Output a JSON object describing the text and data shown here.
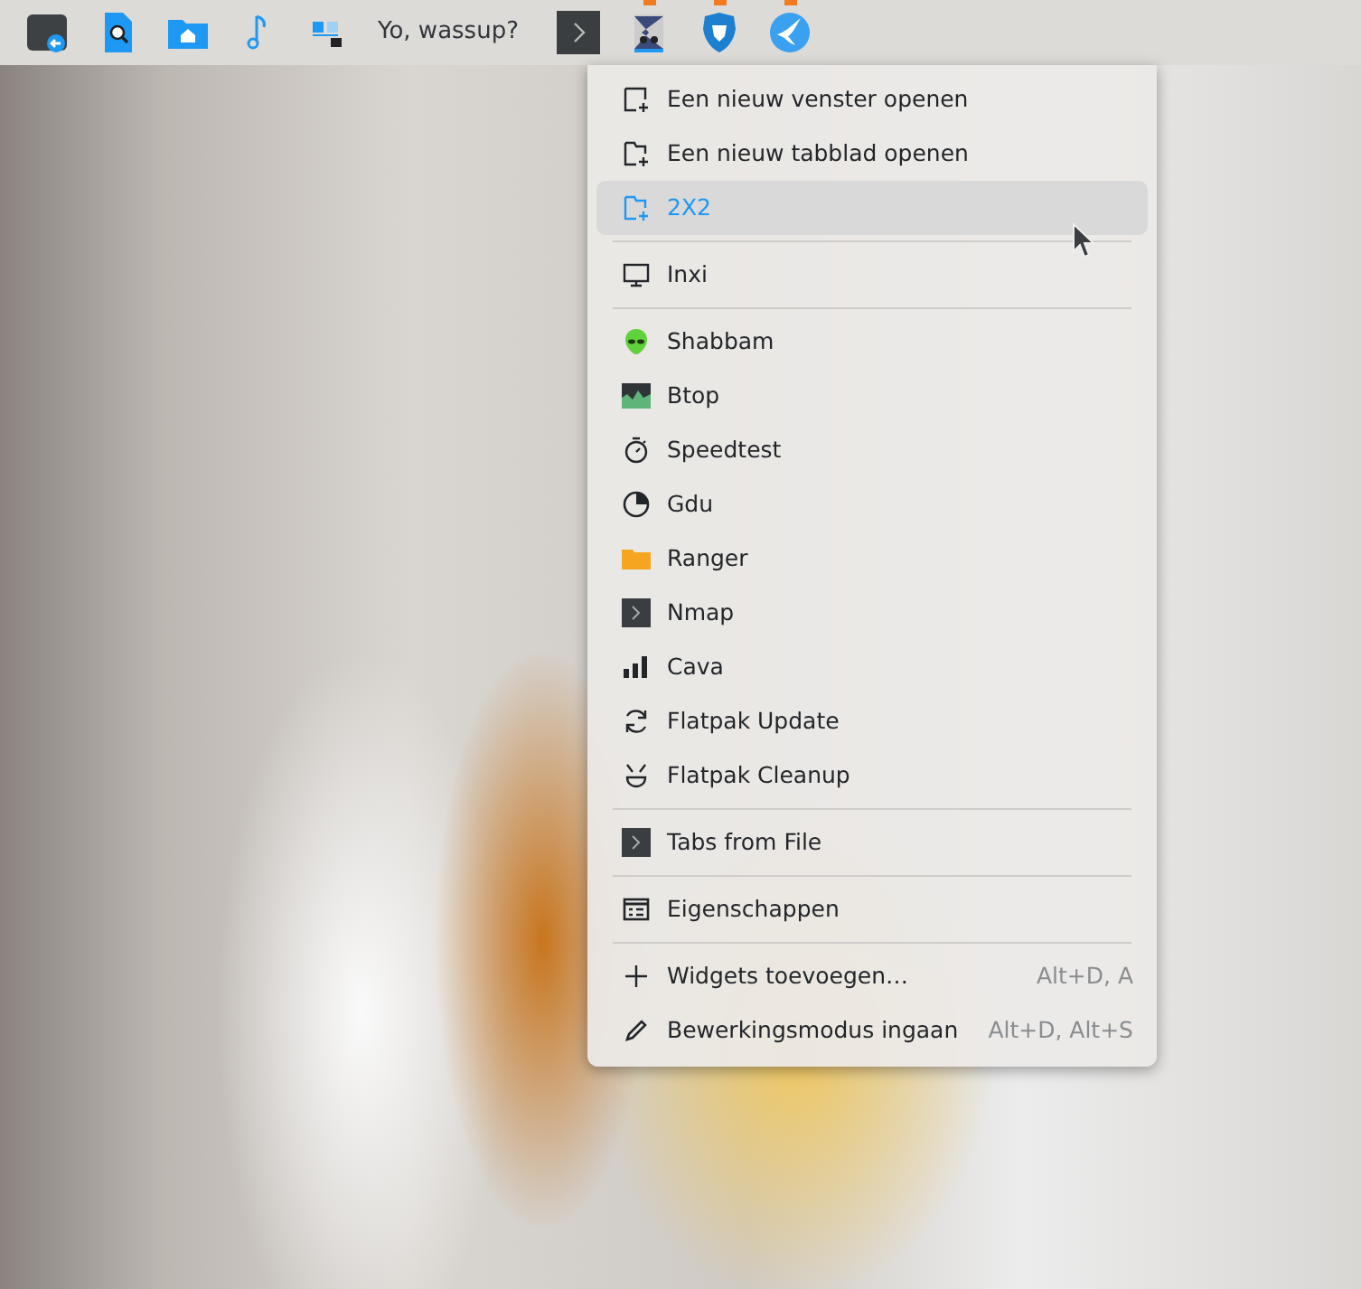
{
  "panel": {
    "items": [
      {
        "kind": "launcher",
        "running": false
      },
      {
        "kind": "launcher",
        "running": false
      },
      {
        "kind": "launcher",
        "running": false
      },
      {
        "kind": "launcher",
        "running": false
      },
      {
        "kind": "launcher",
        "running": false
      },
      {
        "kind": "text",
        "label": "Yo, wassup?"
      },
      {
        "kind": "launcher",
        "running": false
      },
      {
        "kind": "launcher",
        "running": true
      },
      {
        "kind": "launcher",
        "running": true
      },
      {
        "kind": "launcher",
        "running": true
      }
    ]
  },
  "menu": {
    "groups": [
      [
        {
          "label": "Een nieuw venster openen",
          "selected": false
        },
        {
          "label": "Een nieuw tabblad openen",
          "selected": false
        },
        {
          "label": "2X2",
          "selected": true
        }
      ],
      [
        {
          "label": "Inxi",
          "selected": false
        }
      ],
      [
        {
          "label": "Shabbam",
          "selected": false
        },
        {
          "label": "Btop",
          "selected": false
        },
        {
          "label": "Speedtest",
          "selected": false
        },
        {
          "label": "Gdu",
          "selected": false
        },
        {
          "label": "Ranger",
          "selected": false
        },
        {
          "label": "Nmap",
          "selected": false
        },
        {
          "label": "Cava",
          "selected": false
        },
        {
          "label": "Flatpak Update",
          "selected": false
        },
        {
          "label": "Flatpak Cleanup",
          "selected": false
        }
      ],
      [
        {
          "label": "Tabs from File",
          "selected": false
        }
      ],
      [
        {
          "label": "Eigenschappen",
          "selected": false
        }
      ],
      [
        {
          "label": "Widgets toevoegen…",
          "shortcut": "Alt+D, A",
          "selected": false
        },
        {
          "label": "Bewerkingsmodus ingaan",
          "shortcut": "Alt+D, Alt+S",
          "selected": false
        }
      ]
    ]
  }
}
